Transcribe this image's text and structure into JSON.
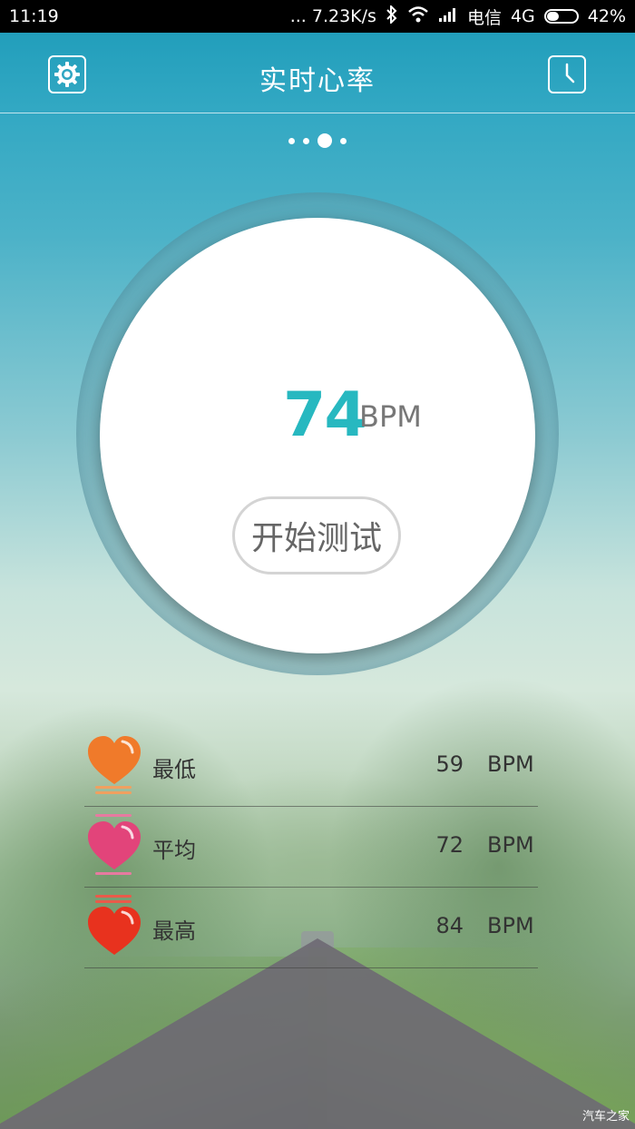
{
  "status_bar": {
    "time": "11:19",
    "network_speed": "... 7.23K/s",
    "carrier": "电信",
    "network_type": "4G",
    "battery": "42%",
    "battery_level": 0.42
  },
  "app_bar": {
    "title": "实时心率",
    "left_icon": "settings-gear-icon",
    "right_icon": "clock-history-icon"
  },
  "pager": {
    "pages": 4,
    "active_index": 2
  },
  "measurement": {
    "value": "74",
    "unit": "BPM",
    "start_button_label": "开始测试"
  },
  "stats": [
    {
      "label": "最低",
      "value": "59",
      "unit": "BPM",
      "color": "#f07a2a"
    },
    {
      "label": "平均",
      "value": "72",
      "unit": "BPM",
      "color": "#e2447a"
    },
    {
      "label": "最高",
      "value": "84",
      "unit": "BPM",
      "color": "#e8321e"
    }
  ],
  "watermark": "汽车之家"
}
